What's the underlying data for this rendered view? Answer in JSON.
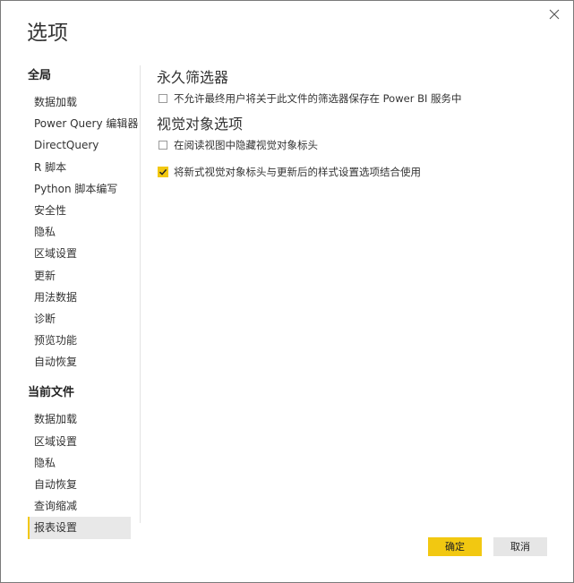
{
  "dialog": {
    "title": "选项",
    "close_icon": "close-icon"
  },
  "sidebar": {
    "global_title": "全局",
    "global_items": [
      "数据加载",
      "Power Query 编辑器",
      "DirectQuery",
      "R 脚本",
      "Python 脚本编写",
      "安全性",
      "隐私",
      "区域设置",
      "更新",
      "用法数据",
      "诊断",
      "预览功能",
      "自动恢复"
    ],
    "file_title": "当前文件",
    "file_items": [
      "数据加载",
      "区域设置",
      "隐私",
      "自动恢复",
      "查询缩减",
      "报表设置"
    ],
    "selected": "报表设置"
  },
  "main": {
    "persistent_filters_title": "永久筛选器",
    "persistent_filters_option": {
      "label": "不允许最终用户将关于此文件的筛选器保存在 Power BI 服务中",
      "checked": false
    },
    "visual_options_title": "视觉对象选项",
    "hide_header_option": {
      "label": "在阅读视图中隐藏视觉对象标头",
      "checked": false
    },
    "new_header_option": {
      "label": "将新式视觉对象标头与更新后的样式设置选项结合使用",
      "checked": true
    }
  },
  "footer": {
    "ok_label": "确定",
    "cancel_label": "取消"
  },
  "colors": {
    "accent": "#f2c811",
    "selected_bg": "#e8e8e8"
  }
}
